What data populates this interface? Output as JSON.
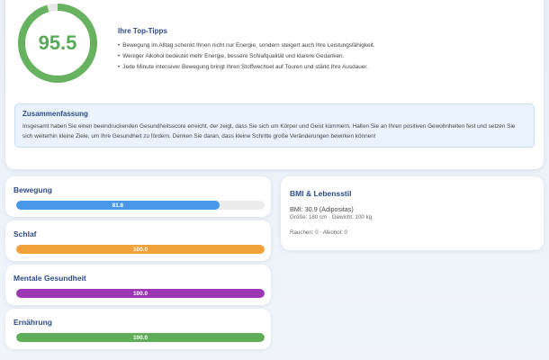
{
  "score": {
    "value": "95.5",
    "percent": 95.5,
    "ring_color": "#66b25e",
    "track_color": "#e6e6e6"
  },
  "tips": {
    "title": "Ihre Top-Tipps",
    "items": [
      "Bewegung im Alltag schenkt Ihnen nicht nur Energie, sondern steigert auch Ihre Leistungsfähigkeit.",
      "Weniger Alkohol bedeutet mehr Energie, bessere Schlafqualität und klarere Gedanken.",
      "Jede Minute intensiver Bewegung bringt Ihren Stoffwechsel auf Touren und stärkt Ihre Ausdauer."
    ]
  },
  "summary": {
    "title": "Zusammenfassung",
    "text": "Insgesamt haben Sie einen beeindruckenden Gesundheitsscore erreicht, der zeigt, dass Sie sich um Körper und Geist kümmern. Halten Sie an Ihren positiven Gewohnheiten fest und setzen Sie sich weiterhin kleine Ziele, um Ihre Gesundheit zu fördern. Denken Sie daran, dass kleine Schritte große Veränderungen bewirken können!"
  },
  "metrics": [
    {
      "label": "Bewegung",
      "value": "81.8",
      "percent": 81.8,
      "color": "#4a97e8"
    },
    {
      "label": "Schlaf",
      "value": "100.0",
      "percent": 100,
      "color": "#f0a13a"
    },
    {
      "label": "Mentale Gesundheit",
      "value": "100.0",
      "percent": 100,
      "color": "#9c36b5"
    },
    {
      "label": "Ernährung",
      "value": "100.0",
      "percent": 100,
      "color": "#5fae57"
    }
  ],
  "bmi": {
    "title": "BMI & Lebensstil",
    "main": "BMI: 30.9 (Adipositas)",
    "details": "Größe: 180 cm · Gewicht: 100 kg",
    "lifestyle": "Rauchen: 0 · Alkohol: 0"
  }
}
